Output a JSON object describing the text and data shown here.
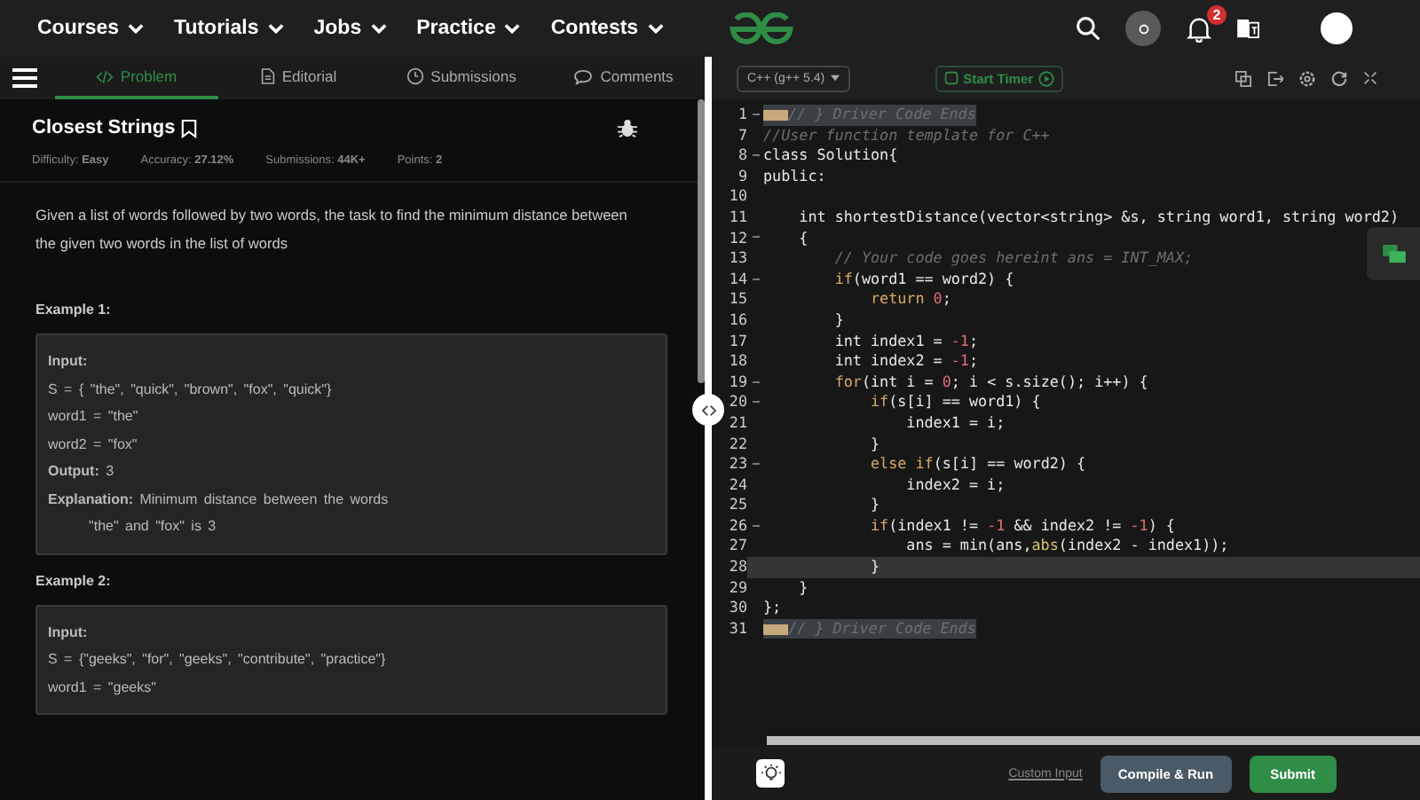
{
  "nav": {
    "menus": [
      {
        "label": "Courses"
      },
      {
        "label": "Tutorials"
      },
      {
        "label": "Jobs"
      },
      {
        "label": "Practice"
      },
      {
        "label": "Contests"
      }
    ],
    "notification_count": "2"
  },
  "tabs": [
    {
      "label": "Problem",
      "selected": true
    },
    {
      "label": "Editorial",
      "selected": false
    },
    {
      "label": "Submissions",
      "selected": false
    },
    {
      "label": "Comments",
      "selected": false
    }
  ],
  "problem": {
    "title": "Closest Strings",
    "stats": [
      "Difficulty: **Easy**",
      "Accuracy: **27.12%**",
      "Submissions: **44K+**",
      "Points: **2**"
    ],
    "description": "Given a list of words followed by two words, the task to find the minimum distance between the given two words in the list of words",
    "examples": [
      {
        "heading": "Example 1:",
        "lines": [
          "**Input:**",
          "S = { \"the\", \"quick\", \"brown\", \"fox\", \"quick\"}",
          "word1 = \"the\"",
          "word2 = \"fox\"",
          "**Output:** 3",
          "**Explanation:** Minimum distance between the words \"the\" and \"fox\" is 3"
        ]
      },
      {
        "heading": "Example 2:",
        "lines": [
          "**Input:**",
          "S = {\"geeks\", \"for\", \"geeks\", \"contribute\", \"practice\"}",
          "word1 = \"geeks\""
        ]
      }
    ]
  },
  "editor": {
    "language": "C++ (g++ 5.4)",
    "timer_label": "Start Timer",
    "lines": [
      {
        "number": "1",
        "fold": true,
        "folded": true,
        "active": false,
        "tokens": [
          {
            "kind": "c",
            "t": "// } Driver Code Ends"
          }
        ]
      },
      {
        "number": "7",
        "fold": false,
        "folded": false,
        "active": false,
        "tokens": [
          {
            "kind": "c",
            "t": "//User function template for C++"
          }
        ]
      },
      {
        "number": "8",
        "fold": true,
        "folded": false,
        "active": false,
        "tokens": [
          {
            "kind": "p",
            "t": "class Solution{"
          }
        ]
      },
      {
        "number": "9",
        "fold": false,
        "folded": false,
        "active": false,
        "tokens": [
          {
            "kind": "p",
            "t": "public:"
          }
        ]
      },
      {
        "number": "10",
        "fold": false,
        "folded": false,
        "active": false
      },
      {
        "number": "11",
        "fold": false,
        "folded": false,
        "active": false,
        "tokens": [
          {
            "kind": "p",
            "t": "    int shortestDistance(vector<string> &s, string word1, string word2)"
          }
        ]
      },
      {
        "number": "12",
        "fold": true,
        "folded": false,
        "active": false,
        "tokens": [
          {
            "kind": "p",
            "t": "    {"
          }
        ]
      },
      {
        "number": "13",
        "fold": false,
        "folded": false,
        "active": false,
        "tokens": [
          {
            "kind": "c",
            "t": "        // Your code goes hereint ans = INT_MAX;"
          }
        ]
      },
      {
        "number": "14",
        "fold": true,
        "folded": false,
        "active": false,
        "tokens": [
          {
            "kind": "k",
            "t": "        if"
          },
          {
            "kind": "p",
            "t": "(word1 == word2) {"
          }
        ]
      },
      {
        "number": "15",
        "fold": false,
        "folded": false,
        "active": false,
        "tokens": [
          {
            "kind": "k",
            "t": "            return"
          },
          {
            "kind": "n",
            "t": " 0"
          },
          {
            "kind": "p",
            "t": ";"
          }
        ]
      },
      {
        "number": "16",
        "fold": false,
        "folded": false,
        "active": false,
        "tokens": [
          {
            "kind": "p",
            "t": "        }"
          }
        ]
      },
      {
        "number": "17",
        "fold": false,
        "folded": false,
        "active": false,
        "tokens": [
          {
            "kind": "p",
            "t": "        int index1 = "
          },
          {
            "kind": "n",
            "t": "-1"
          },
          {
            "kind": "p",
            "t": ";"
          }
        ]
      },
      {
        "number": "18",
        "fold": false,
        "folded": false,
        "active": false,
        "tokens": [
          {
            "kind": "p",
            "t": "        int index2 = "
          },
          {
            "kind": "n",
            "t": "-1"
          },
          {
            "kind": "p",
            "t": ";"
          }
        ]
      },
      {
        "number": "19",
        "fold": true,
        "folded": false,
        "active": false,
        "tokens": [
          {
            "kind": "k",
            "t": "        for"
          },
          {
            "kind": "p",
            "t": "(int i = "
          },
          {
            "kind": "n",
            "t": "0"
          },
          {
            "kind": "p",
            "t": "; i < s.size(); i++) {"
          }
        ]
      },
      {
        "number": "20",
        "fold": true,
        "folded": false,
        "active": false,
        "tokens": [
          {
            "kind": "k",
            "t": "            if"
          },
          {
            "kind": "p",
            "t": "(s[i] == word1) {"
          }
        ]
      },
      {
        "number": "21",
        "fold": false,
        "folded": false,
        "active": false,
        "tokens": [
          {
            "kind": "p",
            "t": "                index1 = i;"
          }
        ]
      },
      {
        "number": "22",
        "fold": false,
        "folded": false,
        "active": false,
        "tokens": [
          {
            "kind": "p",
            "t": "            }"
          }
        ]
      },
      {
        "number": "23",
        "fold": true,
        "folded": false,
        "active": false,
        "tokens": [
          {
            "kind": "k",
            "t": "            else if"
          },
          {
            "kind": "p",
            "t": "(s[i] == word2) {"
          }
        ]
      },
      {
        "number": "24",
        "fold": false,
        "folded": false,
        "active": false,
        "tokens": [
          {
            "kind": "p",
            "t": "                index2 = i;"
          }
        ]
      },
      {
        "number": "25",
        "fold": false,
        "folded": false,
        "active": false,
        "tokens": [
          {
            "kind": "p",
            "t": "            }"
          }
        ]
      },
      {
        "number": "26",
        "fold": true,
        "folded": false,
        "active": false,
        "tokens": [
          {
            "kind": "k",
            "t": "            if"
          },
          {
            "kind": "p",
            "t": "(index1 != "
          },
          {
            "kind": "n",
            "t": "-1"
          },
          {
            "kind": "p",
            "t": " && index2 != "
          },
          {
            "kind": "n",
            "t": "-1"
          },
          {
            "kind": "p",
            "t": ") {"
          }
        ]
      },
      {
        "number": "27",
        "fold": false,
        "folded": false,
        "active": false,
        "tokens": [
          {
            "kind": "p",
            "t": "                ans = min(ans,"
          },
          {
            "kind": "f",
            "t": "abs"
          },
          {
            "kind": "p",
            "t": "(index2 - index1));"
          }
        ]
      },
      {
        "number": "28",
        "fold": false,
        "folded": false,
        "active": true,
        "tokens": [
          {
            "kind": "p",
            "t": "            }"
          }
        ]
      },
      {
        "number": "29",
        "fold": false,
        "folded": false,
        "active": false,
        "tokens": [
          {
            "kind": "p",
            "t": "    }"
          }
        ]
      },
      {
        "number": "30",
        "fold": false,
        "folded": false,
        "active": false,
        "tokens": [
          {
            "kind": "p",
            "t": "};"
          }
        ]
      },
      {
        "number": "31",
        "fold": false,
        "folded": true,
        "active": false,
        "tokens": [
          {
            "kind": "c",
            "t": "// } Driver Code Ends"
          }
        ]
      }
    ]
  },
  "footer": {
    "custom_input": "Custom Input",
    "compile": "Compile & Run",
    "submit": "Submit"
  }
}
